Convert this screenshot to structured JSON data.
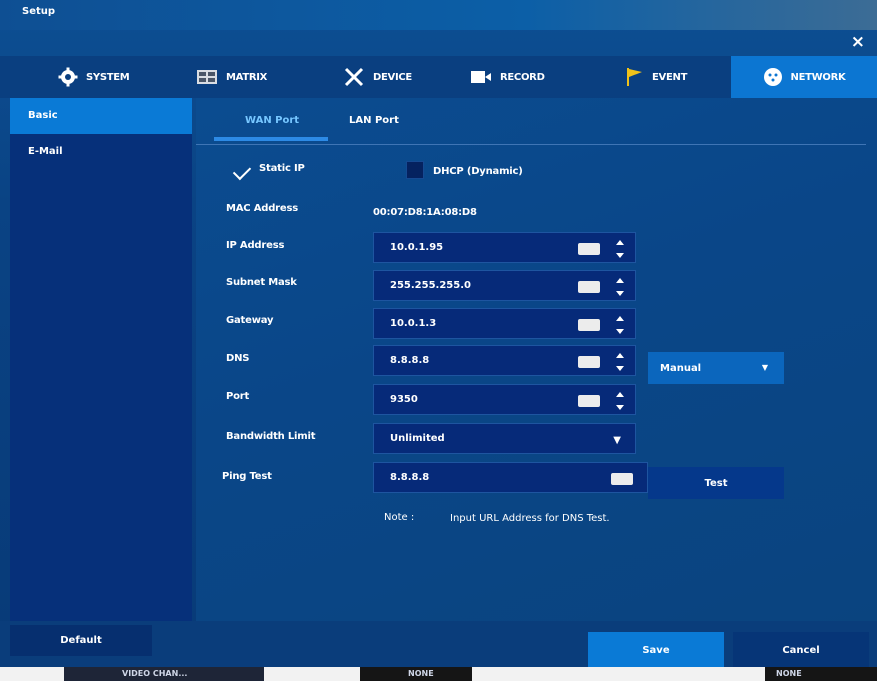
{
  "window": {
    "title": "Setup",
    "close_icon": "×"
  },
  "tabs": [
    {
      "label": "SYSTEM",
      "icon": "gear-icon"
    },
    {
      "label": "MATRIX",
      "icon": "matrix-icon"
    },
    {
      "label": "DEVICE",
      "icon": "device-icon"
    },
    {
      "label": "RECORD",
      "icon": "record-icon"
    },
    {
      "label": "EVENT",
      "icon": "flag-icon"
    },
    {
      "label": "NETWORK",
      "icon": "network-icon",
      "active": true
    }
  ],
  "sidebar": {
    "items": [
      {
        "label": "Basic",
        "active": true
      },
      {
        "label": "E-Mail"
      }
    ]
  },
  "subtabs": [
    {
      "label": "WAN Port",
      "active": true
    },
    {
      "label": "LAN Port"
    }
  ],
  "form": {
    "static_ip_label": "Static IP",
    "dhcp_label": "DHCP (Dynamic)",
    "mac_label": "MAC Address",
    "mac_value": "00:07:D8:1A:08:D8",
    "ip_label": "IP Address",
    "ip_value": "10.0.1.95",
    "subnet_label": "Subnet Mask",
    "subnet_value": "255.255.255.0",
    "gateway_label": "Gateway",
    "gateway_value": "10.0.1.3",
    "dns_label": "DNS",
    "dns_value": "8.8.8.8",
    "dns_mode": "Manual",
    "port_label": "Port",
    "port_value": "9350",
    "bandwidth_label": "Bandwidth Limit",
    "bandwidth_value": "Unlimited",
    "ping_label": "Ping Test",
    "ping_value": "8.8.8.8",
    "test_button": "Test",
    "note_title": "Note :",
    "note_text": "Input URL Address for DNS Test."
  },
  "footer": {
    "default_label": "Default",
    "save_label": "Save",
    "cancel_label": "Cancel"
  },
  "bottom_strip": {
    "left": "VIDEO CHAN...",
    "middle": "NONE",
    "right": "NONE"
  },
  "colors": {
    "accent": "#0a7ad6",
    "panel": "#0a4384",
    "field": "#062a79"
  }
}
